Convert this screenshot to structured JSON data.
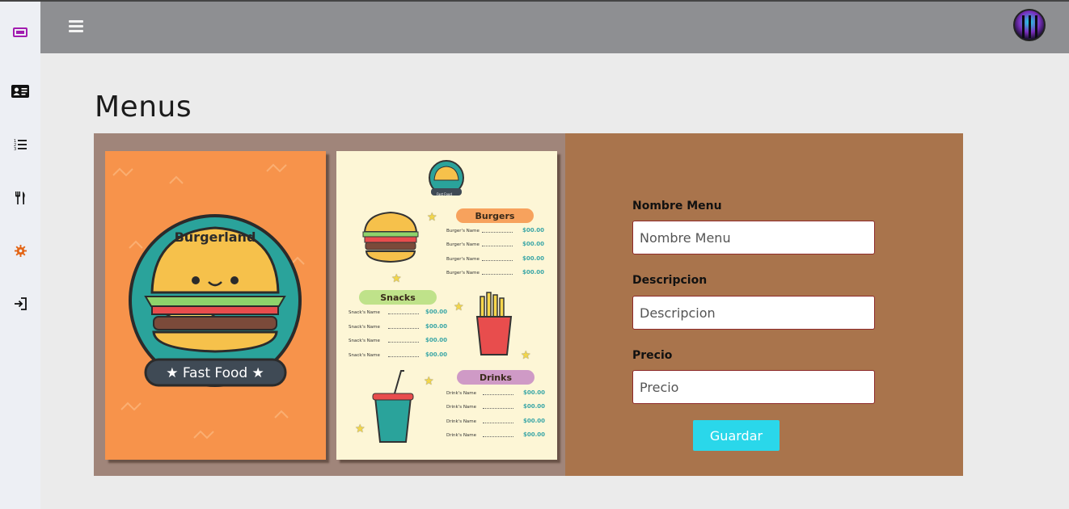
{
  "sidebar": {
    "items": [
      {
        "icon": "ticket-icon",
        "color": "#a21caf"
      },
      {
        "icon": "id-card-icon",
        "color": "#111111"
      },
      {
        "icon": "ordered-list-icon",
        "color": "#111111"
      },
      {
        "icon": "utensils-icon",
        "color": "#111111"
      },
      {
        "icon": "gear-icon",
        "color": "#e36414"
      },
      {
        "icon": "sign-in-icon",
        "color": "#111111"
      }
    ]
  },
  "topbar": {
    "menu_icon": "hamburger-icon",
    "avatar": "avatar"
  },
  "page": {
    "title": "Menus"
  },
  "menu_image": {
    "front": {
      "brand": "Burgerland",
      "banner": "★ Fast Food ★"
    },
    "back": {
      "badge": "Fast Food",
      "sections": [
        {
          "title": "Burgers",
          "items": [
            {
              "name": "Burger's Name",
              "price": "$00.00"
            },
            {
              "name": "Burger's Name",
              "price": "$00.00"
            },
            {
              "name": "Burger's Name",
              "price": "$00.00"
            },
            {
              "name": "Burger's Name",
              "price": "$00.00"
            }
          ]
        },
        {
          "title": "Snacks",
          "items": [
            {
              "name": "Snack's Name",
              "price": "$00.00"
            },
            {
              "name": "Snack's Name",
              "price": "$00.00"
            },
            {
              "name": "Snack's Name",
              "price": "$00.00"
            },
            {
              "name": "Snack's Name",
              "price": "$00.00"
            }
          ]
        },
        {
          "title": "Drinks",
          "items": [
            {
              "name": "Drink's Name",
              "price": "$00.00"
            },
            {
              "name": "Drink's Name",
              "price": "$00.00"
            },
            {
              "name": "Drink's Name",
              "price": "$00.00"
            },
            {
              "name": "Drink's Name",
              "price": "$00.00"
            }
          ]
        }
      ]
    }
  },
  "form": {
    "name_label": "Nombre Menu",
    "name_placeholder": "Nombre Menu",
    "desc_label": "Descripcion",
    "desc_placeholder": "Descripcion",
    "price_label": "Precio",
    "price_placeholder": "Precio",
    "submit_label": "Guardar"
  },
  "colors": {
    "topbar": "#8e8f92",
    "form_panel": "#a9744c",
    "image_panel": "#a0857a",
    "button": "#2ad7ea"
  }
}
